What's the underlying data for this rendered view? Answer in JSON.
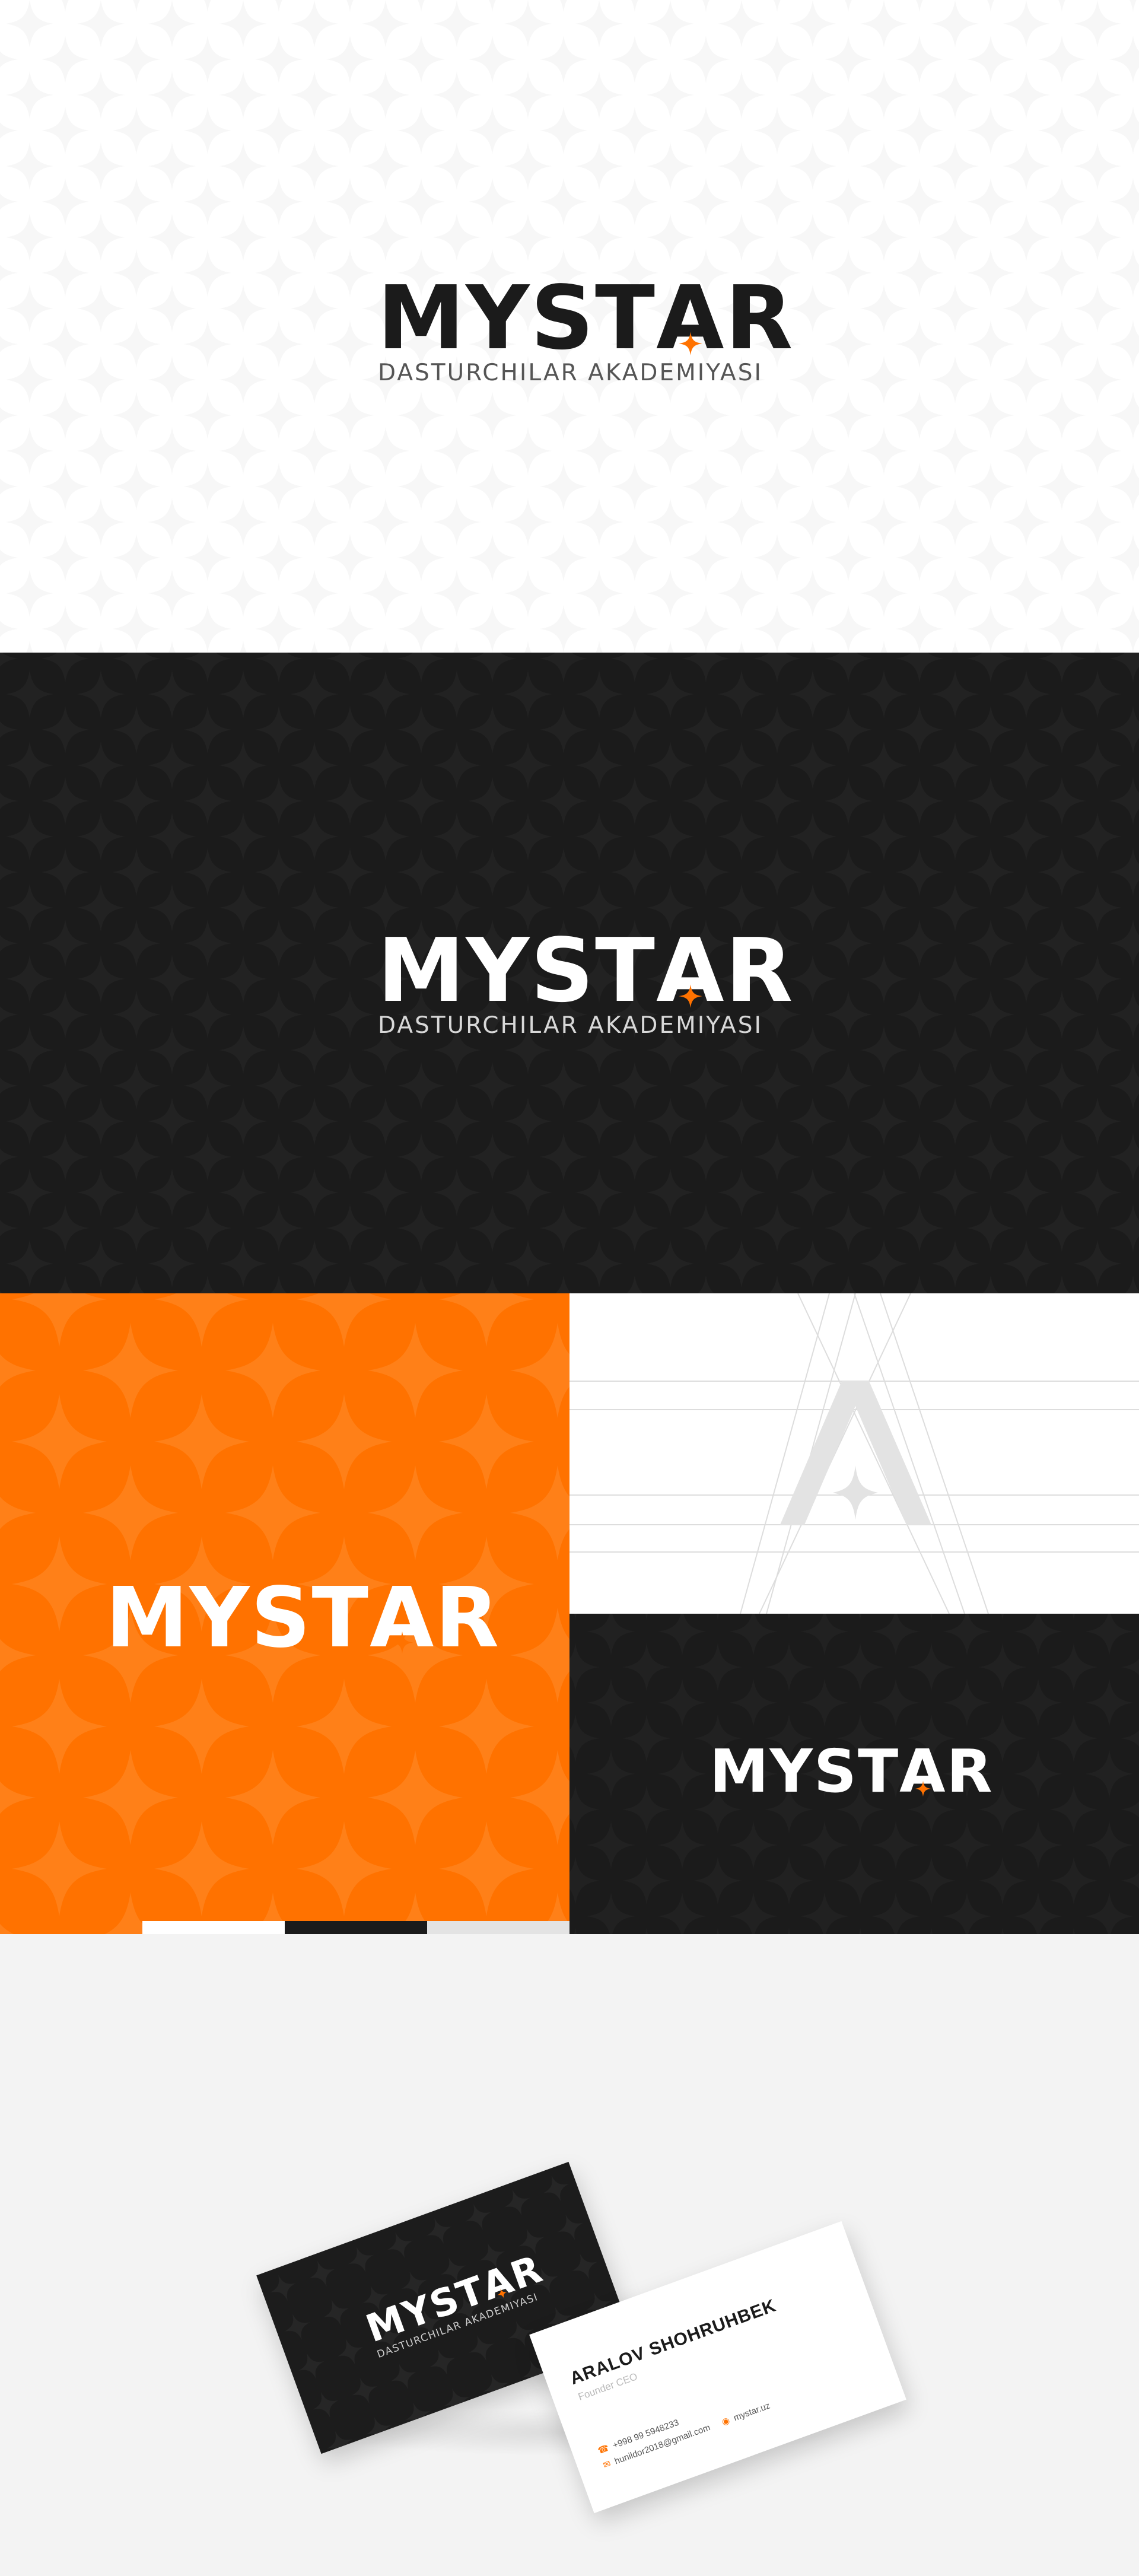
{
  "brand": {
    "name_prefix": "MYST",
    "name_a": "A",
    "name_suffix": "R",
    "tagline": "DASTURCHILAR AKADEMIYASI"
  },
  "colors": {
    "orange": "#ff7200",
    "dark": "#1b1b1b",
    "white": "#ffffff",
    "light_gray": "#f3f3f3",
    "swatches": [
      "#ffffff",
      "#1b1b1b",
      "#e3e3e3"
    ]
  },
  "icons": {
    "brand_star": "four-point-star-icon",
    "phone": "phone-icon",
    "email": "email-icon",
    "web": "globe-icon"
  },
  "business_card": {
    "name": "ARALOV SHOHRUHBEK",
    "title": "Founder CEO",
    "phone": "+998 99 5948233",
    "email": "hunildor2018@gmail.com",
    "website": "mystar.uz"
  }
}
